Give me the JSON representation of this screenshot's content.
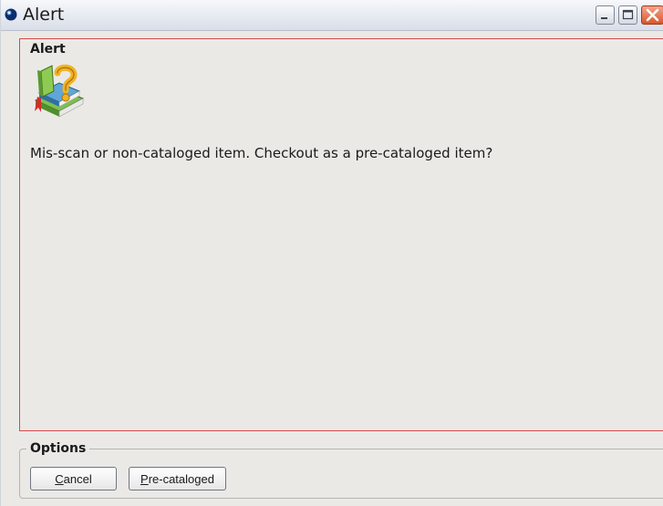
{
  "window": {
    "title": "Alert",
    "icons": [
      "globe-app-icon",
      "minimize-icon",
      "maximize-icon",
      "close-icon"
    ]
  },
  "alert": {
    "label": "Alert",
    "icon": "book-question-icon",
    "message": "Mis-scan or non-cataloged item. Checkout as a pre-cataloged item?"
  },
  "options": {
    "label": "Options",
    "cancel": {
      "mnemonic": "C",
      "rest": "ancel"
    },
    "precataloged": {
      "mnemonic": "P",
      "rest": "re-cataloged"
    }
  },
  "colors": {
    "panel_border": "#d44a4a",
    "background": "#ebe9e6",
    "close_button": "#d9562d"
  }
}
